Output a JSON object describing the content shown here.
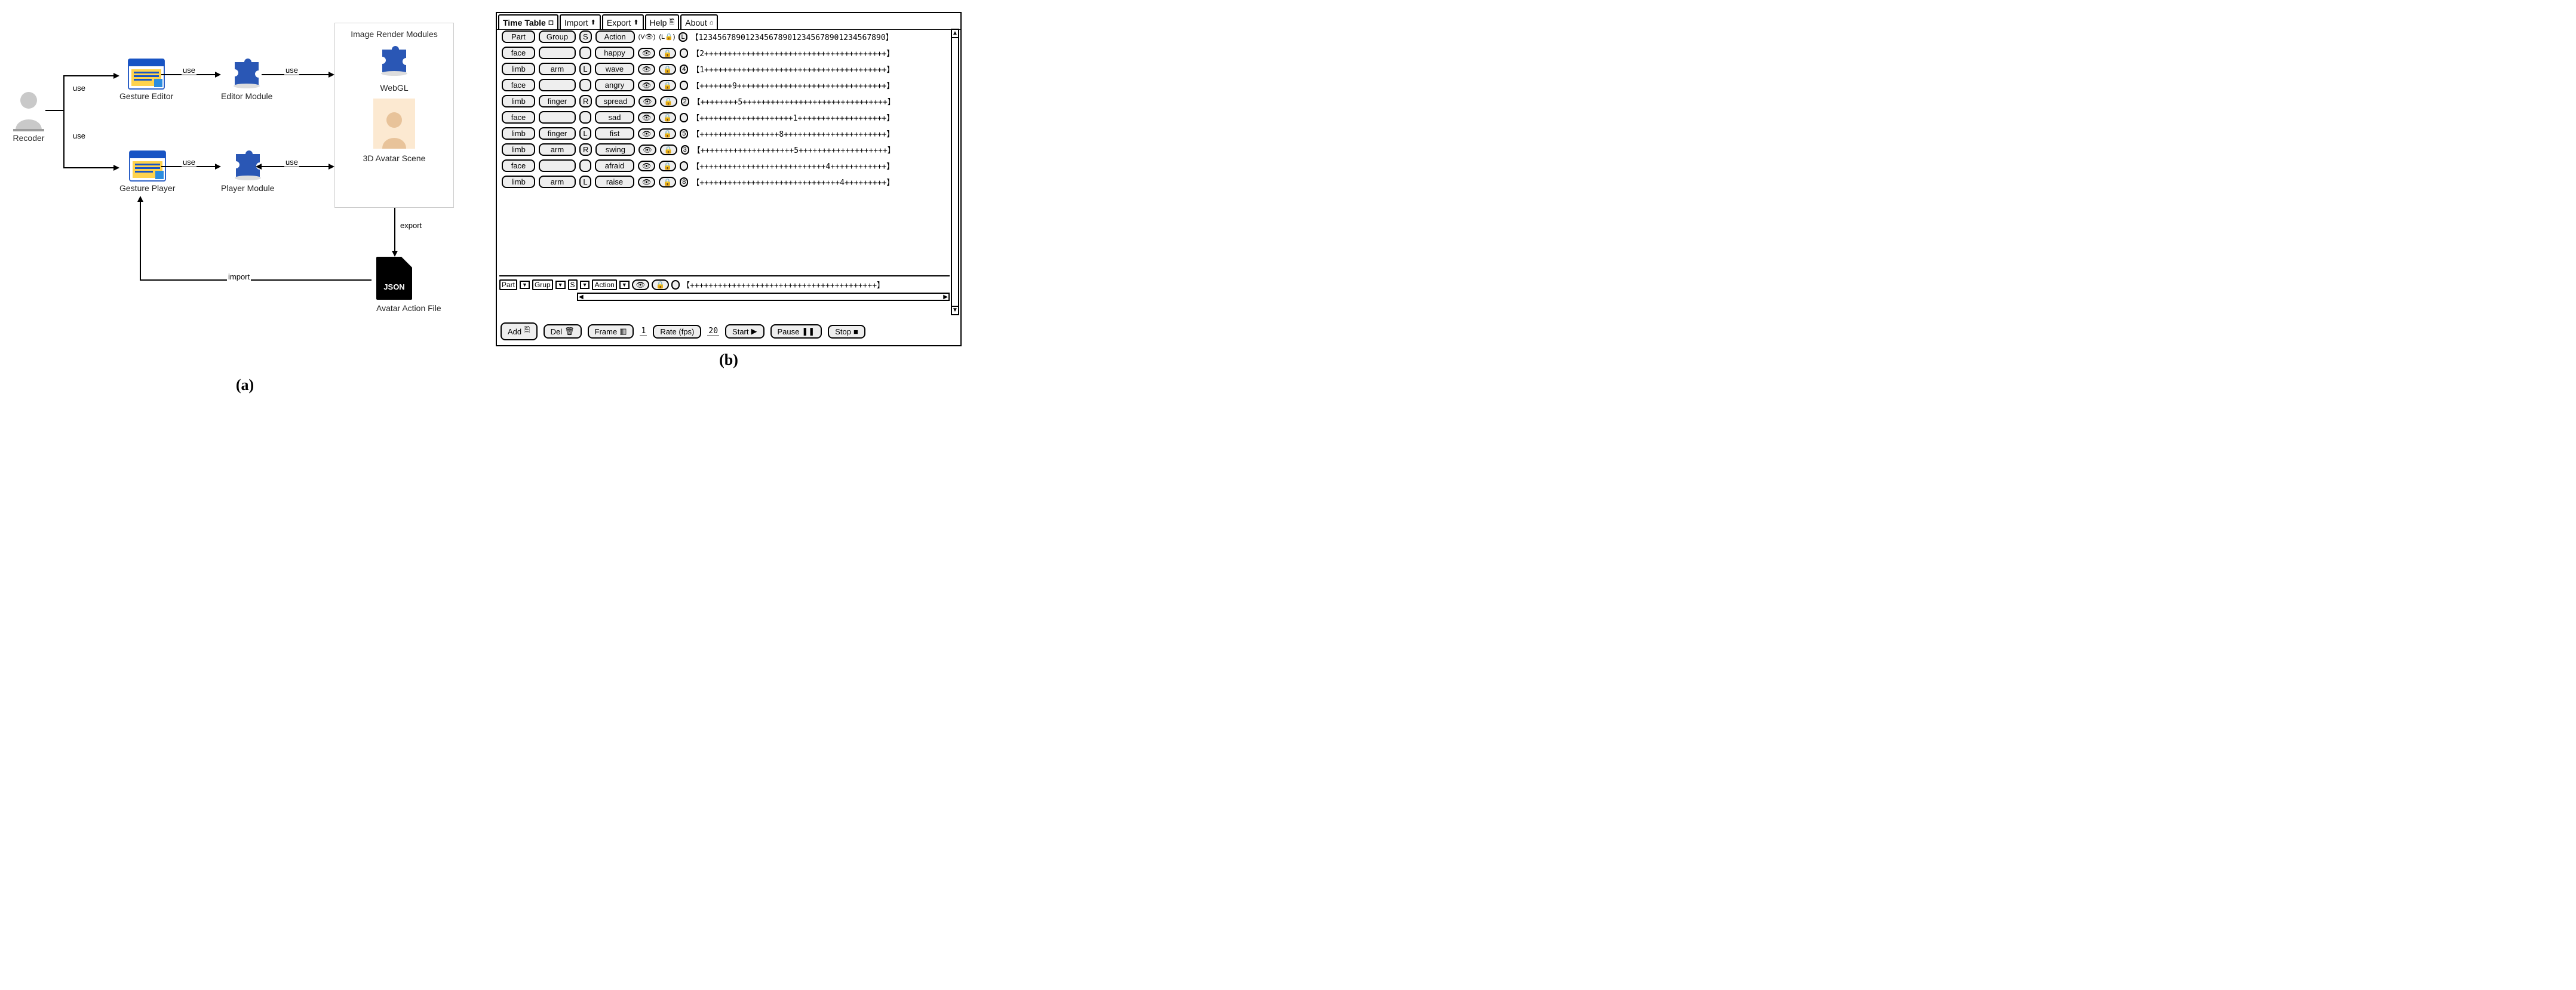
{
  "panelA": {
    "recoder_label": "Recoder",
    "gesture_editor_label": "Gesture Editor",
    "editor_module_label": "Editor Module",
    "gesture_player_label": "Gesture Player",
    "player_module_label": "Player Module",
    "render_box_title": "Image Render Modules",
    "webgl_label": "WebGL",
    "avatar_scene_label": "3D Avatar Scene",
    "json_label": "JSON",
    "avatar_file_label": "Avatar Action File",
    "edge_use": "use",
    "edge_export": "export",
    "edge_import": "import",
    "caption": "(a)"
  },
  "panelB": {
    "tabs": [
      {
        "label": "Time Table",
        "icon": "◻",
        "active": true
      },
      {
        "label": "Import",
        "icon": "⬆"
      },
      {
        "label": "Export",
        "icon": "⬆"
      },
      {
        "label": "Help",
        "icon": "🖺"
      },
      {
        "label": "About",
        "icon": "⌂"
      }
    ],
    "header": {
      "part": "Part",
      "group": "Group",
      "s": "S",
      "action": "Action",
      "vis_hint": "(V👁)",
      "lock_hint": "(L🔒)",
      "layer": "L",
      "ruler": "【1234567890123456789012345678901234567890】"
    },
    "rows": [
      {
        "part": "face",
        "group": "",
        "side": "",
        "action": "happy",
        "layer": "",
        "timeline": "【2+++++++++++++++++++++++++++++++++++++++】"
      },
      {
        "part": "limb",
        "group": "arm",
        "side": "L",
        "action": "wave",
        "layer": "4",
        "timeline": "【1+++++++++++++++++++++++++++++++++++++++】"
      },
      {
        "part": "face",
        "group": "",
        "side": "",
        "action": "angry",
        "layer": "",
        "timeline": "【+++++++9++++++++++++++++++++++++++++++++】"
      },
      {
        "part": "limb",
        "group": "finger",
        "side": "R",
        "action": "spread",
        "layer": "2",
        "timeline": "【++++++++5+++++++++++++++++++++++++++++++】"
      },
      {
        "part": "face",
        "group": "",
        "side": "",
        "action": "sad",
        "layer": "",
        "timeline": "【++++++++++++++++++++1+++++++++++++++++++】"
      },
      {
        "part": "limb",
        "group": "finger",
        "side": "L",
        "action": "fist",
        "layer": "5",
        "timeline": "【+++++++++++++++++8++++++++++++++++++++++】"
      },
      {
        "part": "limb",
        "group": "arm",
        "side": "R",
        "action": "swing",
        "layer": "3",
        "timeline": "【++++++++++++++++++++5+++++++++++++++++++】"
      },
      {
        "part": "face",
        "group": "",
        "side": "",
        "action": "afraid",
        "layer": "",
        "timeline": "【+++++++++++++++++++++++++++4++++++++++++】"
      },
      {
        "part": "limb",
        "group": "arm",
        "side": "L",
        "action": "raise",
        "layer": "8",
        "timeline": "【++++++++++++++++++++++++++++++4+++++++++】"
      }
    ],
    "new_row": {
      "part": "Part",
      "group": "Grup",
      "s": "S",
      "action": "Action",
      "timeline": "【++++++++++++++++++++++++++++++++++++++++】"
    },
    "footer": {
      "add": "Add",
      "del": "Del",
      "frame": "Frame",
      "frame_val": "1",
      "rate": "Rate (fps)",
      "rate_val": "20",
      "start": "Start",
      "pause": "Pause",
      "stop": "Stop"
    },
    "caption": "(b)"
  }
}
